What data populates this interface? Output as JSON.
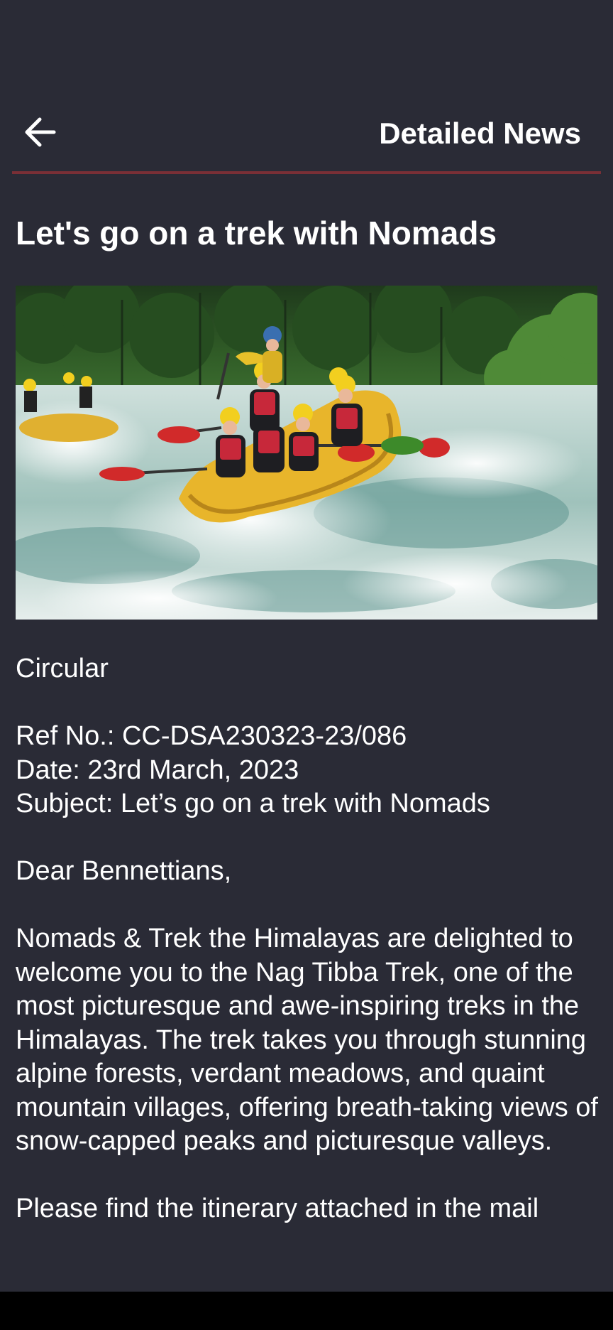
{
  "header": {
    "back_icon": "arrow-left-icon",
    "title": "Detailed News",
    "accent_color": "#7a2f36"
  },
  "news": {
    "title": "Let's go on a trek with Nomads",
    "image_subject": "white-water rafting team in yellow raft",
    "body": "Circular\n\nRef No.: CC-DSA230323-23/086\nDate: 23rd March, 2023\nSubject: Let’s go on a trek with Nomads\n\nDear Bennettians,\n\nNomads & Trek the Himalayas are delighted to welcome you to the Nag Tibba Trek, one of the most picturesque and awe-inspiring treks in the Himalayas. The trek takes you through stunning alpine forests, verdant meadows, and quaint mountain villages, offering breath-taking views of snow-capped peaks and picturesque valleys.\n\nPlease find the itinerary attached in the mail"
  },
  "theme": {
    "background": "#2a2b36",
    "text": "#ffffff"
  }
}
